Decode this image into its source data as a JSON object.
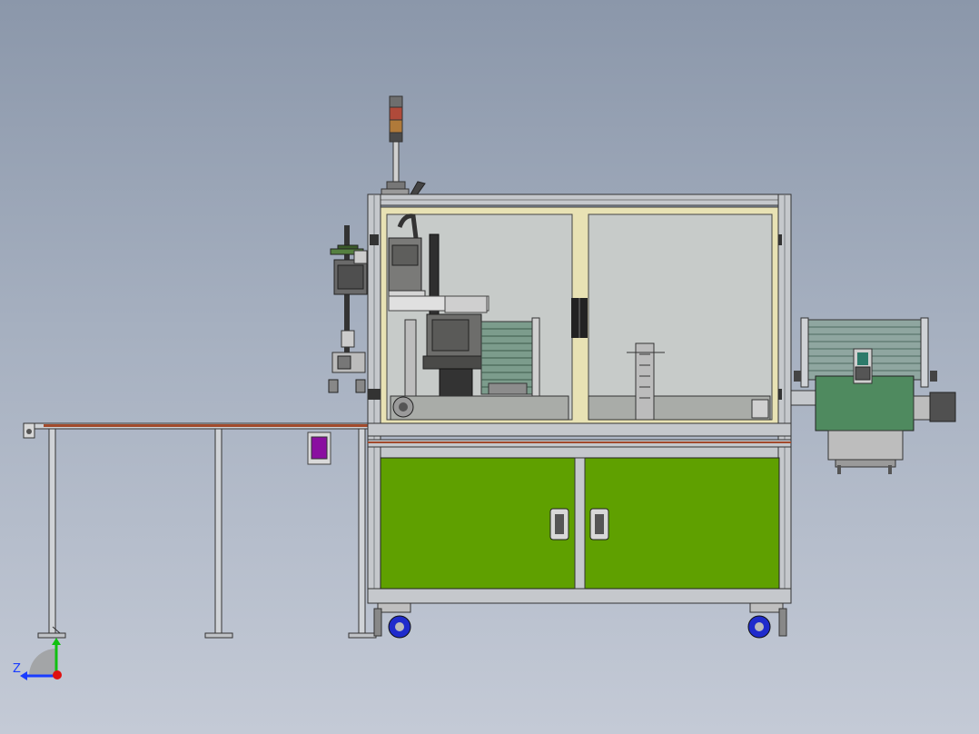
{
  "viewport": {
    "background_top": "#8b97aa",
    "background_bottom": "#c4cad6"
  },
  "colors": {
    "frame": "#b8bcc2",
    "frame_dark": "#5d6166",
    "glass": "#c7cbc9",
    "glass_border": "#e8e2b4",
    "cabinet_panel": "#5fa000",
    "conveyor_belt": "#4f8a5f",
    "rail_top": "#a24a2c",
    "caster": "#1f2bcc",
    "tool_panel": "#8a0fa0"
  },
  "axis_triad": {
    "z_label": "Z",
    "x_color": "#e01010",
    "y_color": "#10c010",
    "z_color": "#1a3cff"
  },
  "icons": {
    "triad": "axis-triad-icon",
    "handle": "cabinet-handle-icon",
    "caster": "caster-wheel-icon",
    "signal_tower": "signal-tower-icon"
  }
}
